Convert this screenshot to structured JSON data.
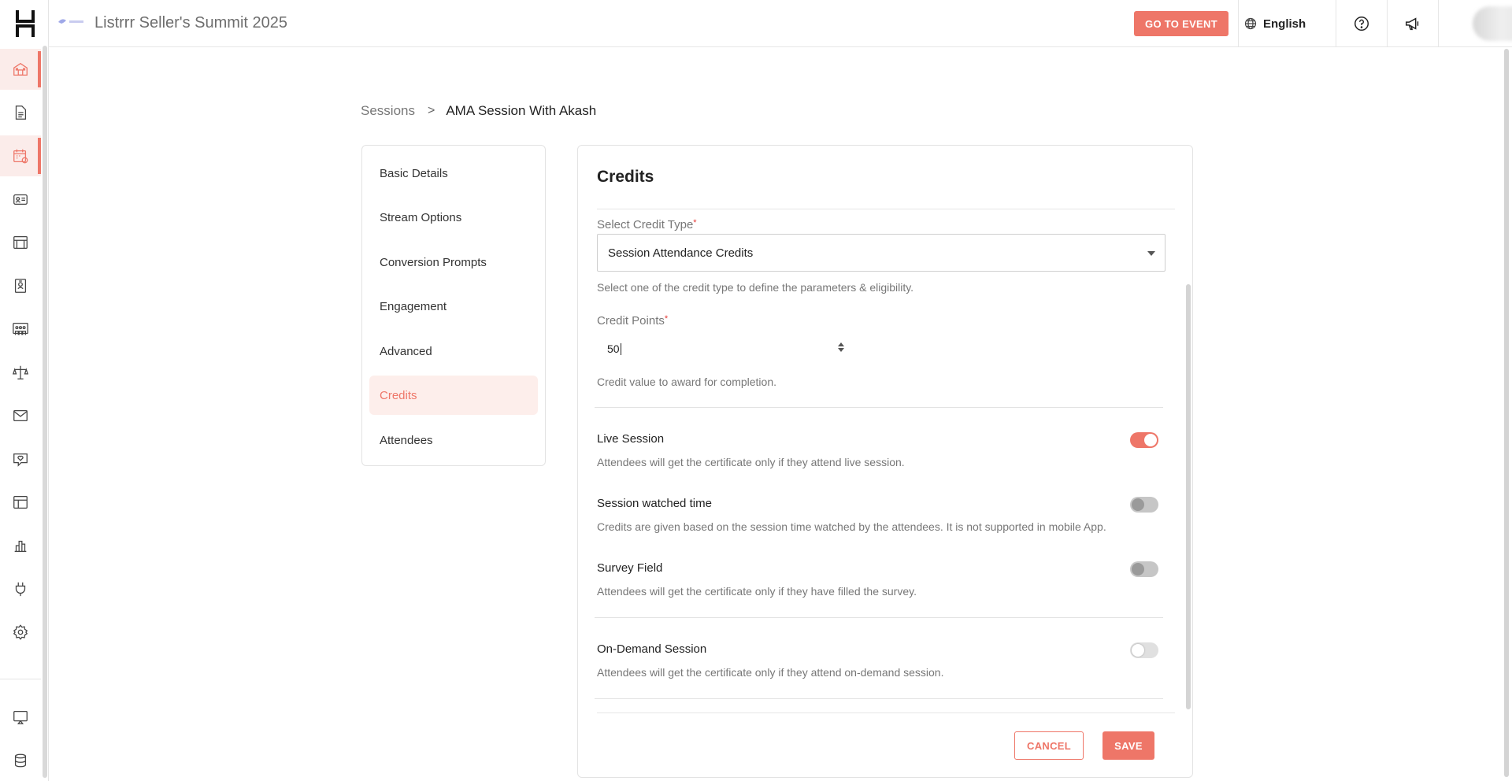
{
  "header": {
    "title": "Listrrr Seller's Summit 2025",
    "go_to_event": "GO TO EVENT",
    "language": "English"
  },
  "rail": {
    "items": [
      {
        "name": "event-home-icon",
        "active": true
      },
      {
        "name": "document-icon",
        "active": false
      },
      {
        "name": "calendar-icon",
        "active": true
      },
      {
        "name": "id-card-icon",
        "active": false
      },
      {
        "name": "booth-icon",
        "active": false
      },
      {
        "name": "badge-icon",
        "active": false
      },
      {
        "name": "lounge-icon",
        "active": false
      },
      {
        "name": "networking-icon",
        "active": false
      },
      {
        "name": "mail-icon",
        "active": false
      },
      {
        "name": "chat-heart-icon",
        "active": false
      },
      {
        "name": "layout-icon",
        "active": false
      },
      {
        "name": "analytics-icon",
        "active": false
      },
      {
        "name": "integrations-icon",
        "active": false
      },
      {
        "name": "settings-icon",
        "active": false
      },
      {
        "name": "present-icon",
        "active": false
      },
      {
        "name": "database-icon",
        "active": false
      }
    ]
  },
  "breadcrumb": {
    "parent": "Sessions",
    "separator": ">",
    "current": "AMA Session With Akash"
  },
  "section_nav": {
    "items": [
      {
        "label": "Basic Details",
        "active": false
      },
      {
        "label": "Stream Options",
        "active": false
      },
      {
        "label": "Conversion Prompts",
        "active": false
      },
      {
        "label": "Engagement",
        "active": false
      },
      {
        "label": "Advanced",
        "active": false
      },
      {
        "label": "Credits",
        "active": true
      },
      {
        "label": "Attendees",
        "active": false
      }
    ]
  },
  "credits": {
    "title": "Credits",
    "credit_type_label": "Select Credit Type",
    "credit_type_value": "Session Attendance Credits",
    "credit_type_hint": "Select one of the credit type to define the parameters & eligibility.",
    "points_label": "Credit Points",
    "points_value": "50",
    "points_hint": "Credit value to award for completion.",
    "required_mark": "*",
    "options": [
      {
        "title": "Live Session",
        "desc": "Attendees will get the certificate only if they attend live session.",
        "enabled": true
      },
      {
        "title": "Session watched time",
        "desc": "Credits are given based on the session time watched by the attendees. It is not supported in mobile App.",
        "enabled": false
      },
      {
        "title": "Survey Field",
        "desc": "Attendees will get the certificate only if they have filled the survey.",
        "enabled": false
      },
      {
        "title": "On-Demand Session",
        "desc": "Attendees will get the certificate only if they attend on-demand session.",
        "enabled": false
      }
    ],
    "cancel_label": "CANCEL",
    "save_label": "SAVE"
  },
  "colors": {
    "accent": "#ee7668",
    "active_bg": "#fdeeeb"
  }
}
